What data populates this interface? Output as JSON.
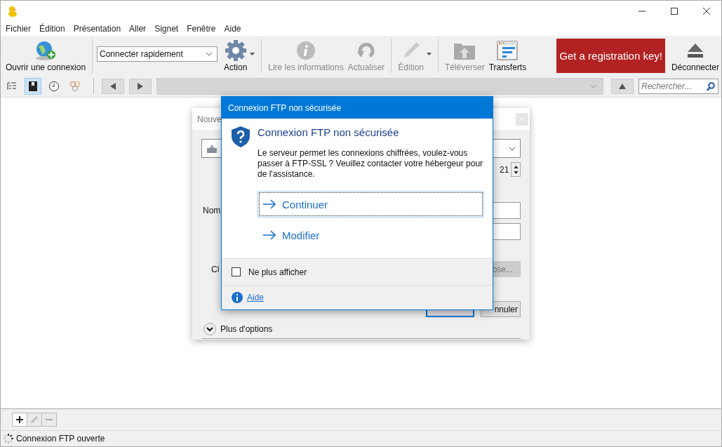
{
  "menu": [
    "Fichier",
    "Édition",
    "Présentation",
    "Aller",
    "Signet",
    "Fenêtre",
    "Aide"
  ],
  "toolbar": {
    "open_label": "Ouvrir une connexion",
    "quick_connect": "Connecter rapidement",
    "items": [
      {
        "kind": "gear",
        "label": "Action",
        "disabled": false,
        "dropdown": true
      },
      {
        "kind": "info",
        "label": "Lire les informations",
        "disabled": true,
        "dropdown": false
      },
      {
        "kind": "refresh",
        "label": "Actualiser",
        "disabled": true,
        "dropdown": false
      },
      {
        "kind": "pencil",
        "label": "Édition",
        "disabled": true,
        "dropdown": true
      },
      {
        "kind": "upload",
        "label": "Téléverser",
        "disabled": true,
        "dropdown": false
      },
      {
        "kind": "transfers",
        "label": "Transferts",
        "disabled": false,
        "dropdown": false
      }
    ],
    "register": "Get a registration key!",
    "disconnect": "Déconnecter"
  },
  "nav": {
    "views": [
      {
        "kind": "outline",
        "selected": false
      },
      {
        "kind": "bookmarks",
        "selected": true
      },
      {
        "kind": "history",
        "selected": false
      },
      {
        "kind": "bonjour",
        "selected": false
      }
    ],
    "search_placeholder": "Rechercher..."
  },
  "back_dialog": {
    "title": "Nouve",
    "port": "21",
    "name_label": "Nom",
    "key_label": "Cl",
    "choose_button": "ose...",
    "cancel_button": "nnuler",
    "more_options": "Plus d'options"
  },
  "dialog": {
    "title": "Connexion FTP non sécurisée",
    "heading": "Connexion FTP non sécurisée",
    "message": "Le serveur permet les connexions chiffrées, voulez-vous passer à FTP-SSL ? Veuillez contacter votre hébergeur pour de l'assistance.",
    "options": [
      {
        "label": "Continuer",
        "focused": true
      },
      {
        "label": "Modifier",
        "focused": false
      }
    ],
    "checkbox": {
      "label": "Ne plus afficher",
      "checked": false
    },
    "help": "Aide"
  },
  "bottom_buttons": [
    {
      "kind": "add",
      "disabled": false
    },
    {
      "kind": "edit",
      "disabled": true
    },
    {
      "kind": "remove",
      "disabled": true
    }
  ],
  "status": "Connexion FTP ouverte"
}
